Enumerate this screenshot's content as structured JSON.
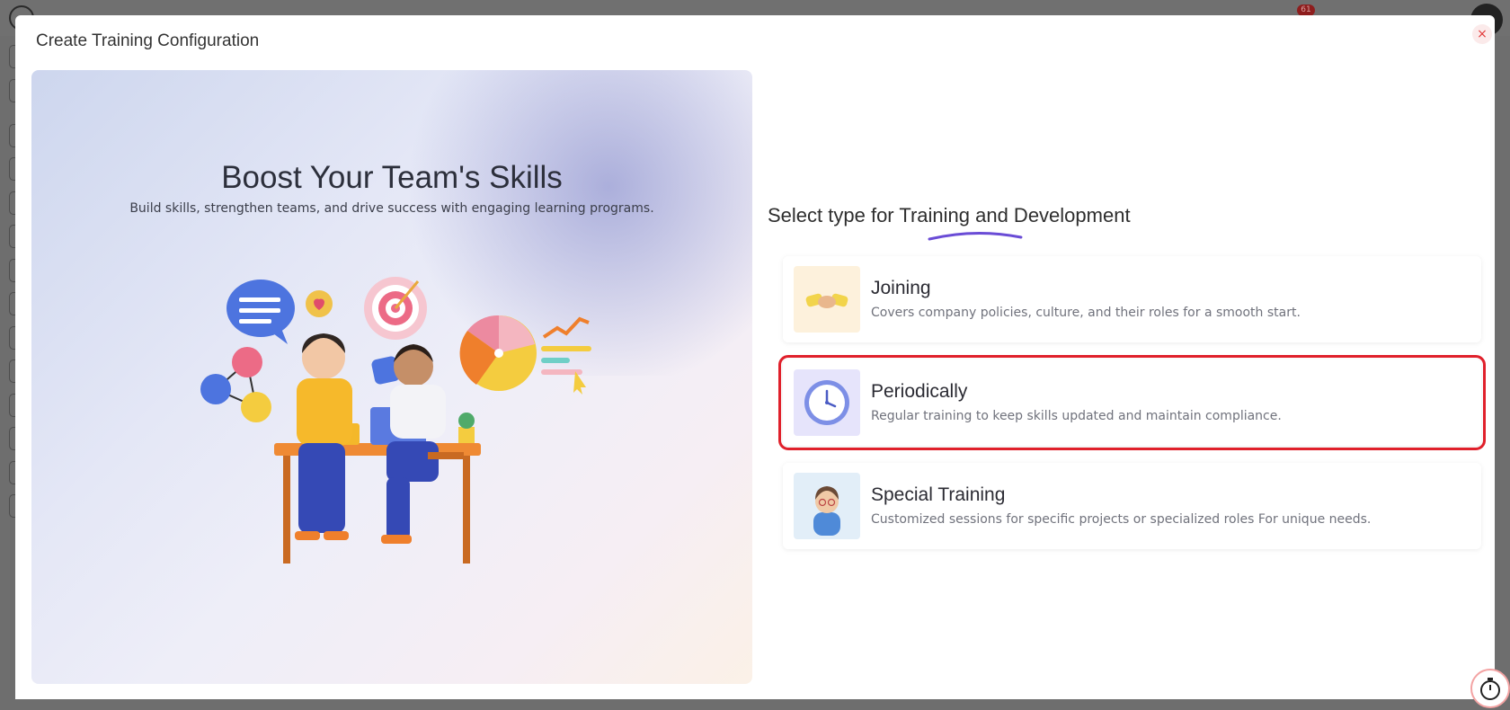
{
  "background": {
    "notification_count": "61"
  },
  "modal": {
    "title": "Create Training Configuration",
    "close_label": "×"
  },
  "hero": {
    "title": "Boost Your Team's Skills",
    "subtitle": "Build skills, strengthen teams, and drive success with engaging learning programs."
  },
  "selection": {
    "title": "Select type for Training and Development",
    "options": [
      {
        "title": "Joining",
        "description": "Covers company policies, culture, and their roles for a smooth start.",
        "icon": "handshake-icon",
        "icon_bg": "#fdf1dc",
        "selected": false
      },
      {
        "title": "Periodically",
        "description": "Regular training to keep skills updated and maintain compliance.",
        "icon": "clock-icon",
        "icon_bg": "#e6e4fb",
        "selected": true
      },
      {
        "title": "Special Training",
        "description": "Customized sessions for specific projects or specialized roles For unique needs.",
        "icon": "trainer-avatar-icon",
        "icon_bg": "#e2eef8",
        "selected": false
      }
    ]
  },
  "colors": {
    "accent_underline": "#6a4cd6",
    "selected_outline": "#e0202b",
    "close": "#e23b3b"
  }
}
